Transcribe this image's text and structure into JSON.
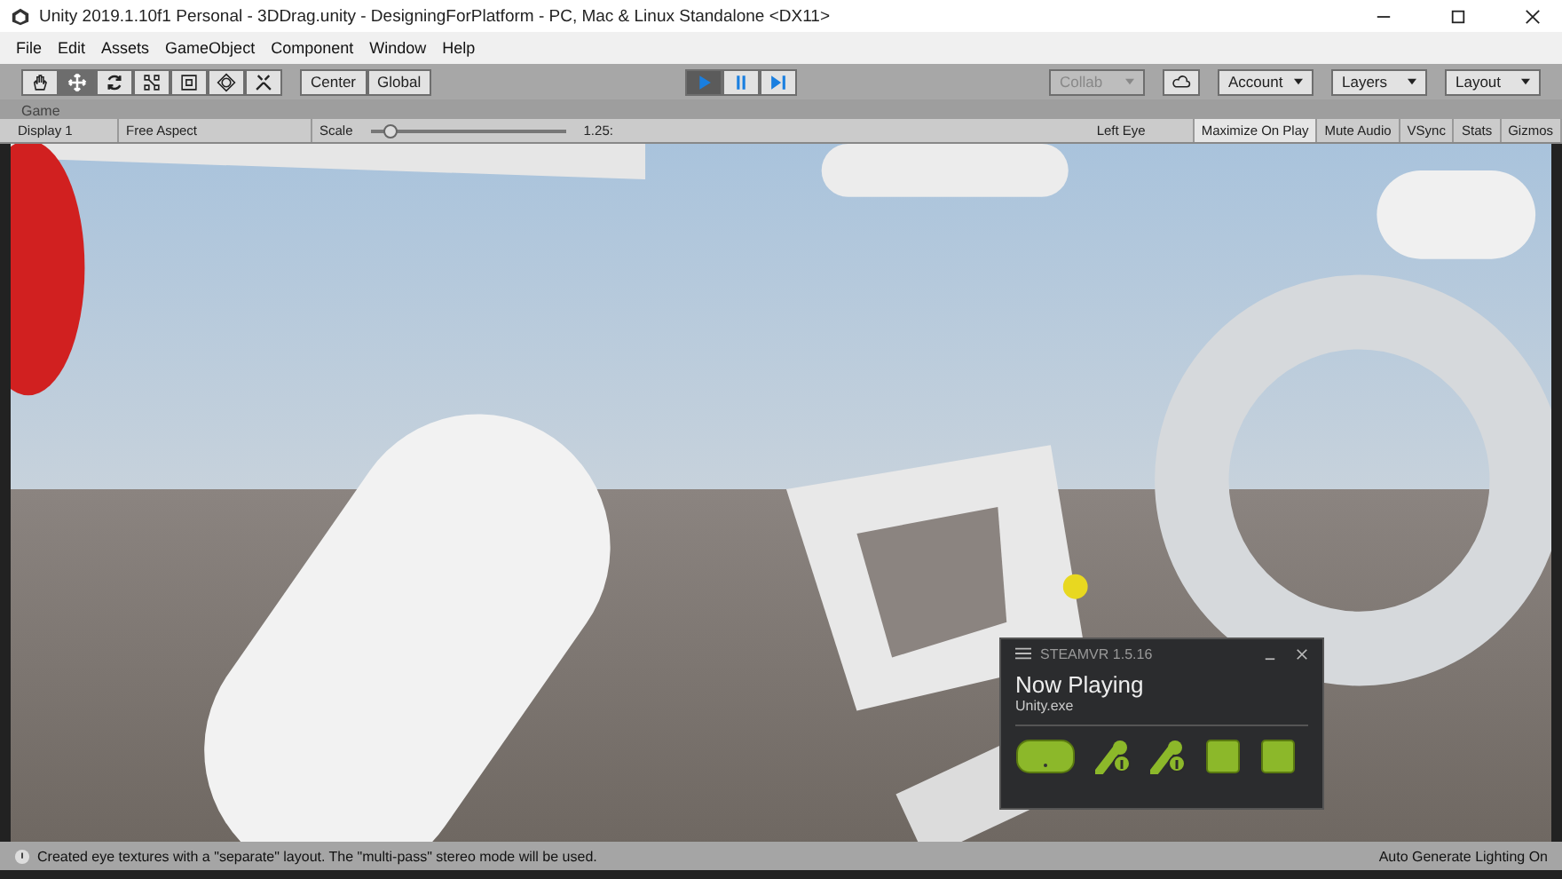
{
  "window": {
    "title": "Unity 2019.1.10f1 Personal - 3DDrag.unity - DesigningForPlatform - PC, Mac & Linux Standalone <DX11>"
  },
  "menu": [
    "File",
    "Edit",
    "Assets",
    "GameObject",
    "Component",
    "Window",
    "Help"
  ],
  "tools": [
    {
      "kind": "hand",
      "selected": false
    },
    {
      "kind": "move",
      "selected": true
    },
    {
      "kind": "rotate",
      "selected": false
    },
    {
      "kind": "scale",
      "selected": false
    },
    {
      "kind": "rect",
      "selected": false
    },
    {
      "kind": "transform",
      "selected": false
    },
    {
      "kind": "custom",
      "selected": false
    }
  ],
  "pivot": [
    "Center",
    "Global"
  ],
  "playback": [
    {
      "kind": "play",
      "selected": true
    },
    {
      "kind": "pause",
      "selected": false
    },
    {
      "kind": "step",
      "selected": false
    }
  ],
  "right_buttons": {
    "collab": "Collab",
    "account": "Account",
    "layers": "Layers",
    "layout": "Layout"
  },
  "game_tab": "Game",
  "game_bar": {
    "display": "Display 1",
    "aspect": "Free Aspect",
    "scale_label": "Scale",
    "scale": {
      "level": 0.1
    },
    "scale_reading": "1.25:",
    "eye": "Left Eye",
    "toggles": [
      {
        "label": "Maximize On Play",
        "on": true
      },
      {
        "label": "Mute Audio",
        "on": false
      },
      {
        "label": "VSync",
        "on": false
      },
      {
        "label": "Stats",
        "on": false
      },
      {
        "label": "Gizmos",
        "on": false
      }
    ]
  },
  "steamvr": {
    "title": "STEAMVR 1.5.16",
    "heading": "Now Playing",
    "app": "Unity.exe",
    "devices": [
      {
        "kind": "headset"
      },
      {
        "kind": "controller"
      },
      {
        "kind": "controller"
      },
      {
        "kind": "station"
      },
      {
        "kind": "station"
      }
    ]
  },
  "status_bar": {
    "message": "Created eye textures with a \"separate\" layout.  The \"multi-pass\" stereo mode will be used.",
    "right": "Auto Generate Lighting On"
  }
}
